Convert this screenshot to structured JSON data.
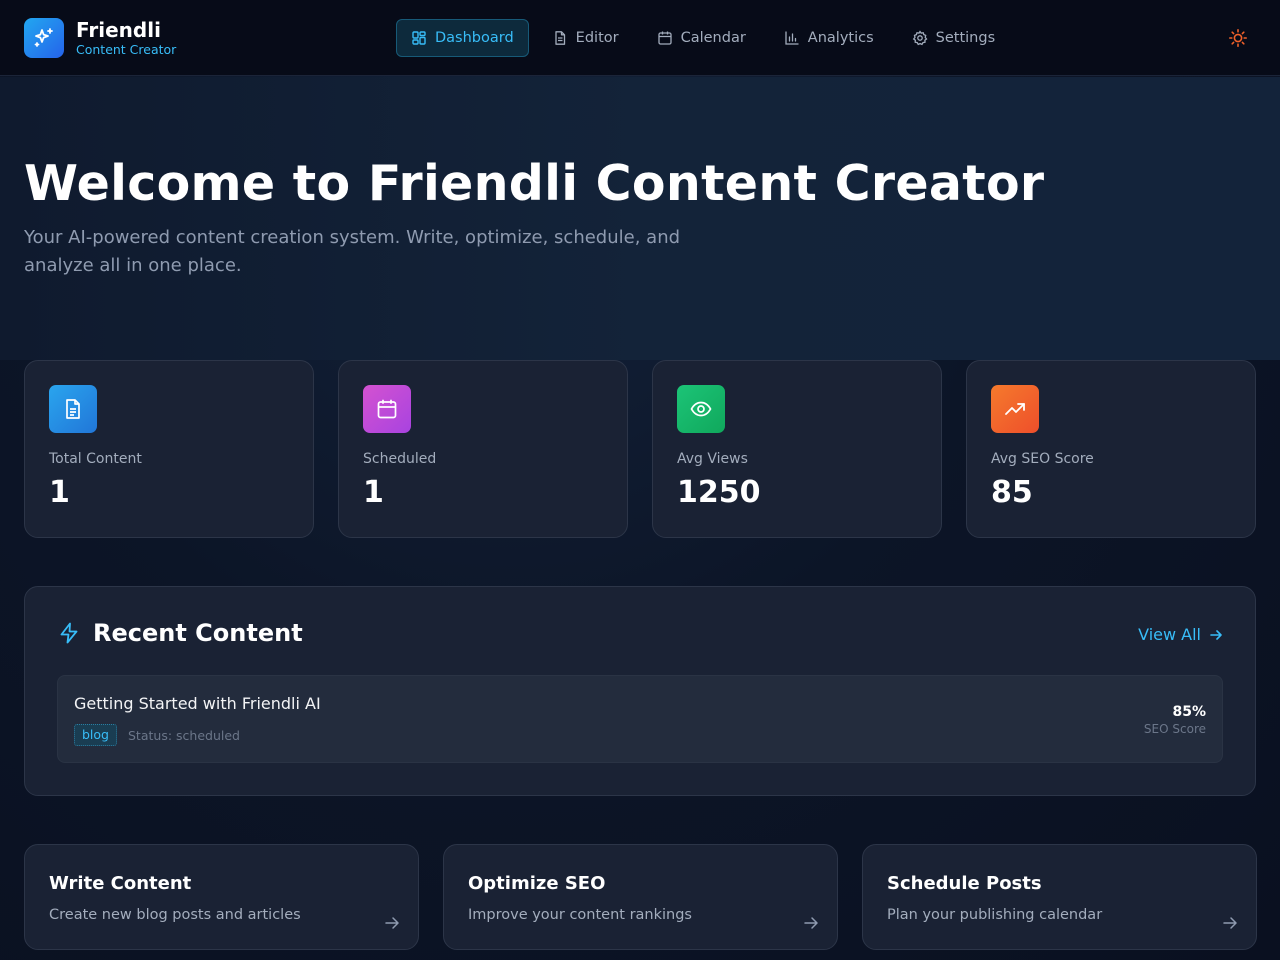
{
  "app": {
    "name": "Friendli",
    "subtitle": "Content Creator"
  },
  "nav": {
    "items": [
      {
        "label": "Dashboard",
        "icon": "dashboard-icon",
        "active": true
      },
      {
        "label": "Editor",
        "icon": "file-icon"
      },
      {
        "label": "Calendar",
        "icon": "calendar-icon"
      },
      {
        "label": "Analytics",
        "icon": "bar-chart-icon"
      },
      {
        "label": "Settings",
        "icon": "gear-icon"
      }
    ],
    "theme_toggle_icon": "sun-icon"
  },
  "hero": {
    "title": "Welcome to Friendli Content Creator",
    "description": "Your AI-powered content creation system. Write, optimize, schedule, and analyze all in one place."
  },
  "stats": [
    {
      "label": "Total Content",
      "value": "1",
      "icon": "document-icon",
      "color": "#2d8be6"
    },
    {
      "label": "Scheduled",
      "value": "1",
      "icon": "calendar-icon",
      "color": "#c94fd8"
    },
    {
      "label": "Avg Views",
      "value": "1250",
      "icon": "eye-icon",
      "color": "#16b86a"
    },
    {
      "label": "Avg SEO Score",
      "value": "85",
      "icon": "trending-up-icon",
      "color": "#f0612a"
    }
  ],
  "recent": {
    "title": "Recent Content",
    "icon": "lightning-icon",
    "view_all": "View All",
    "items": [
      {
        "title": "Getting Started with Friendli AI",
        "tag": "blog",
        "status": "Status: scheduled",
        "seo_score": "85%",
        "seo_label": "SEO Score"
      }
    ]
  },
  "actions": [
    {
      "title": "Write Content",
      "description": "Create new blog posts and articles"
    },
    {
      "title": "Optimize SEO",
      "description": "Improve your content rankings"
    },
    {
      "title": "Schedule Posts",
      "description": "Plan your publishing calendar"
    }
  ],
  "colors": {
    "accent": "#38bdf8",
    "background": "#0c1527",
    "card": "#1a2234"
  }
}
